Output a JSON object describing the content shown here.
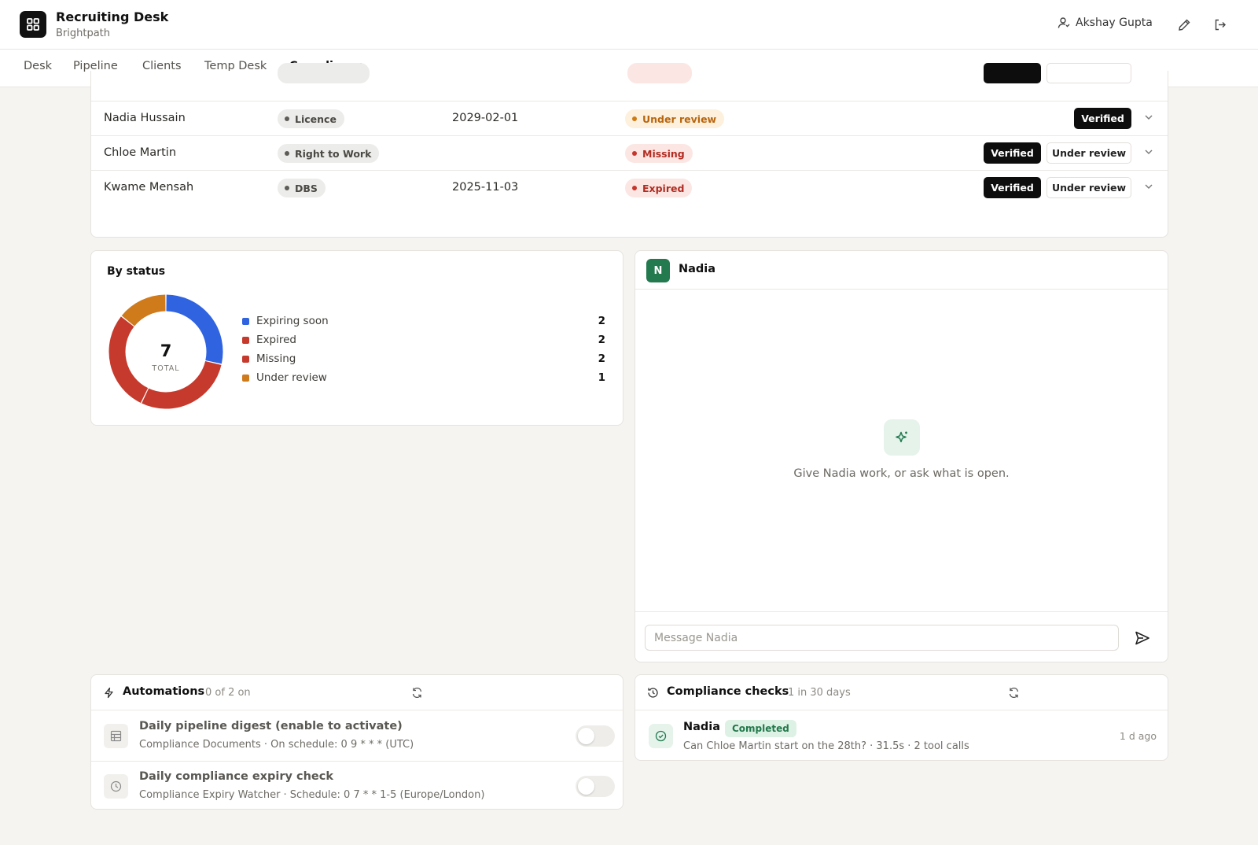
{
  "app": {
    "title": "Recruiting Desk",
    "subtitle": "Brightpath"
  },
  "header": {
    "user_name": "Akshay Gupta",
    "icons": [
      "user-icon",
      "pencil-icon",
      "logout-icon"
    ]
  },
  "tabs": [
    {
      "label": "Desk",
      "active": false
    },
    {
      "label": "Pipeline",
      "active": false
    },
    {
      "label": "Clients",
      "active": false
    },
    {
      "label": "Temp Desk",
      "active": false
    },
    {
      "label": "Compliance",
      "active": true
    }
  ],
  "documents": {
    "rows": [
      {
        "name": "Nadia Hussain",
        "doc_type": "Licence",
        "expiry": "2029-02-01",
        "status": "Under review",
        "status_color": "amber",
        "actions": [
          "Verified"
        ]
      },
      {
        "name": "Chloe Martin",
        "doc_type": "Right to Work",
        "expiry": "",
        "status": "Missing",
        "status_color": "red",
        "actions": [
          "Verified",
          "Under review"
        ]
      },
      {
        "name": "Kwame Mensah",
        "doc_type": "DBS",
        "expiry": "2025-11-03",
        "status": "Expired",
        "status_color": "red",
        "actions": [
          "Verified",
          "Under review"
        ]
      }
    ]
  },
  "status_panel": {
    "title": "By status",
    "total": "7",
    "total_label": "TOTAL",
    "legend": [
      {
        "label": "Expiring soon",
        "count": "2",
        "color": "#2f63e0"
      },
      {
        "label": "Expired",
        "count": "2",
        "color": "#c53a2d"
      },
      {
        "label": "Missing",
        "count": "2",
        "color": "#c53a2d"
      },
      {
        "label": "Under review",
        "count": "1",
        "color": "#cf7a1b"
      }
    ]
  },
  "chart_data": {
    "type": "pie",
    "categories": [
      "Expiring soon",
      "Expired",
      "Missing",
      "Under review"
    ],
    "values": [
      2,
      2,
      2,
      1
    ],
    "colors": [
      "#2f63e0",
      "#c53a2d",
      "#c53a2d",
      "#cf7a1b"
    ],
    "title": "By status"
  },
  "chat": {
    "agent_initial": "N",
    "agent_name": "Nadia",
    "empty_text": "Give Nadia work, or ask what is open.",
    "input_placeholder": "Message Nadia"
  },
  "automations": {
    "title": "Automations",
    "summary": "0 of 2 on",
    "items": [
      {
        "title": "Daily pipeline digest (enable to activate)",
        "detail": "Compliance Documents · On schedule: 0 9 * * * (UTC)",
        "icon": "table-icon",
        "enabled": false
      },
      {
        "title": "Daily compliance expiry check",
        "detail": "Compliance Expiry Watcher · Schedule: 0 7 * * 1-5 (Europe/London)",
        "icon": "clock-icon",
        "enabled": false
      }
    ]
  },
  "checks": {
    "title": "Compliance checks",
    "summary": "1 in 30 days",
    "items": [
      {
        "agent": "Nadia",
        "status": "Completed",
        "detail": "Can Chloe Martin start on the 28th? · 31.5s · 2 tool calls",
        "time": "1 d ago"
      }
    ]
  }
}
